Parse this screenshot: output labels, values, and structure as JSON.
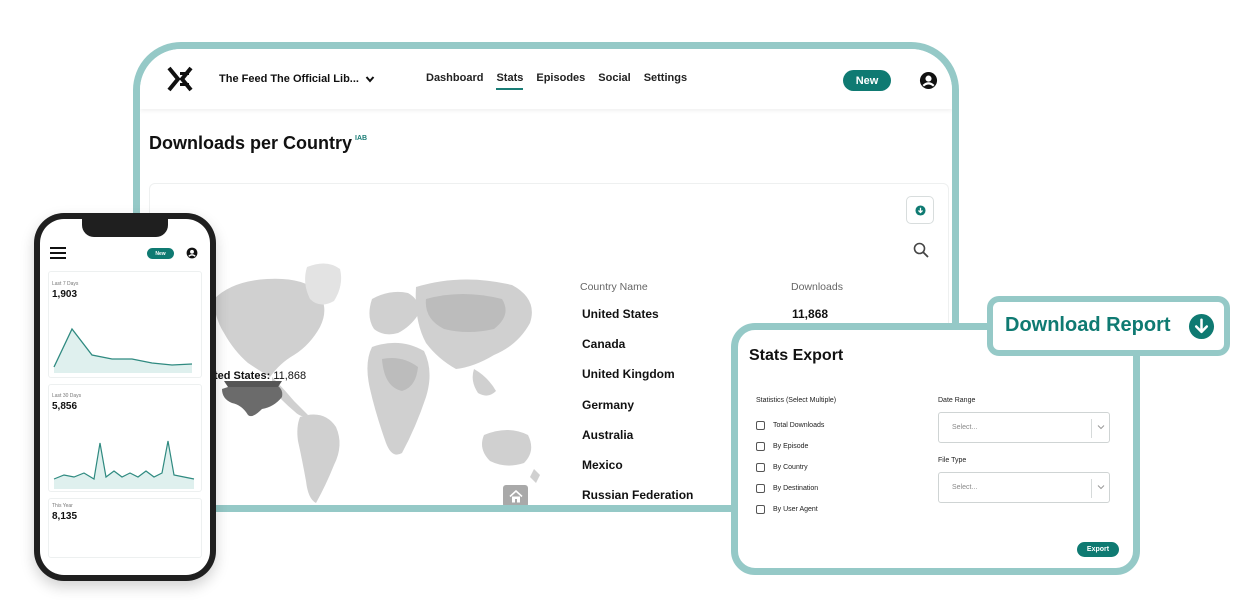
{
  "tablet": {
    "podcast_name": "The Feed The Official Lib...",
    "nav": [
      "Dashboard",
      "Stats",
      "Episodes",
      "Social",
      "Settings"
    ],
    "active_tab": "Stats",
    "new_label": "New",
    "page_title": "Downloads per Country",
    "page_title_badge": "IAB",
    "map_tooltip": {
      "label": "ted States:",
      "value": "11,868"
    },
    "table": {
      "headers": [
        "Country Name",
        "Downloads"
      ],
      "rows": [
        {
          "country": "United States",
          "downloads": "11,868"
        },
        {
          "country": "Canada",
          "downloads": ""
        },
        {
          "country": "United Kingdom",
          "downloads": ""
        },
        {
          "country": "Germany",
          "downloads": ""
        },
        {
          "country": "Australia",
          "downloads": ""
        },
        {
          "country": "Mexico",
          "downloads": ""
        },
        {
          "country": "Russian Federation",
          "downloads": ""
        }
      ]
    }
  },
  "export_modal": {
    "title": "Stats Export",
    "stats_label": "Statistics (Select Multiple)",
    "options": [
      "Total Downloads",
      "By Episode",
      "By Country",
      "By Destination",
      "By User Agent"
    ],
    "date_range": {
      "label": "Date Range",
      "placeholder": "Select..."
    },
    "file_type": {
      "label": "File Type",
      "placeholder": "Select..."
    },
    "export_label": "Export"
  },
  "download_report": {
    "label": "Download Report"
  },
  "phone": {
    "new_label": "New",
    "cards": [
      {
        "period": "Last 7 Days",
        "value": "1,903"
      },
      {
        "period": "Last 30 Days",
        "value": "5,856"
      },
      {
        "period": "This Year",
        "value": "8,135"
      }
    ]
  },
  "colors": {
    "accent": "#0f7a72",
    "frame": "#95c9c7",
    "map_land": "#cfcfcf",
    "map_highlight": "#6b6b6b"
  }
}
